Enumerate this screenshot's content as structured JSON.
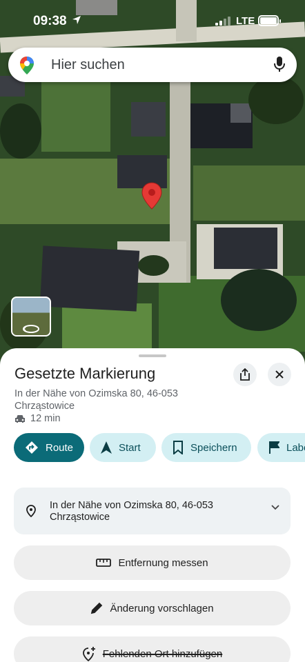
{
  "status_bar": {
    "time": "09:38",
    "network": "LTE"
  },
  "search": {
    "placeholder": "Hier suchen"
  },
  "place": {
    "title": "Gesetzte Markierung",
    "address_line1": "In der Nähe von Ozimska 80, 46-053",
    "address_line2": "Chrząstowice",
    "drive_time": "12 min"
  },
  "chips": [
    {
      "label": "Route",
      "icon": "route-diamond-icon"
    },
    {
      "label": "Start",
      "icon": "navigation-arrow-icon"
    },
    {
      "label": "Speichern",
      "icon": "bookmark-icon"
    },
    {
      "label": "Label",
      "icon": "flag-icon"
    }
  ],
  "address_card": {
    "line1": "In der Nähe von Ozimska 80, 46-053",
    "line2": "Chrząstowice"
  },
  "actions": {
    "measure": "Entfernung messen",
    "suggest_edit": "Änderung vorschlagen",
    "add_place": "Fehlenden Ort hinzufügen"
  },
  "colors": {
    "primary_chip": "#0b6b78",
    "secondary_chip": "#d3eff3",
    "pin": "#e53935"
  }
}
